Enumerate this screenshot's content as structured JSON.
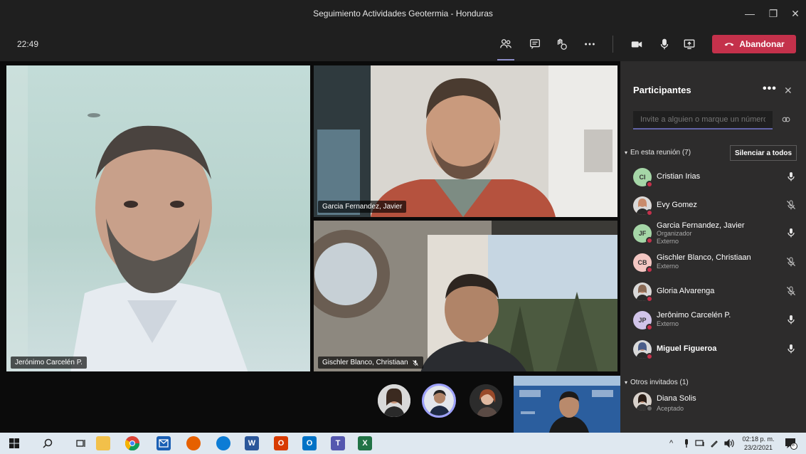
{
  "window": {
    "title": "Seguimiento Actividades Geotermia - Honduras",
    "minimize": "—",
    "restore": "❐",
    "close": "✕"
  },
  "toolbar": {
    "clock": "22:49",
    "leave_label": "Abandonar"
  },
  "tiles": [
    {
      "name": "Jerónimo Carcelén P.",
      "muted": false
    },
    {
      "name": "Garcia Fernandez, Javier",
      "muted": false
    },
    {
      "name": "Gischler Blanco, Christiaan",
      "muted": true
    }
  ],
  "panel": {
    "title": "Participantes",
    "more": "•••",
    "close": "✕",
    "invite_placeholder": "Invite a alguien o marque un número",
    "in_meeting_label": "En esta reunión (7)",
    "mute_all_label": "Silenciar a todos",
    "participants": [
      {
        "initials": "CI",
        "name": "Cristian Irias",
        "role": "",
        "external": "",
        "mic": "on",
        "avatar_color": "#a5d6a7",
        "photo": false,
        "bold": false
      },
      {
        "initials": "",
        "name": "Evy Gomez",
        "role": "",
        "external": "",
        "mic": "off",
        "avatar_color": "#c98b6b",
        "photo": true,
        "bold": false
      },
      {
        "initials": "JF",
        "name": "Garcia Fernandez, Javier",
        "role": "Organizador",
        "external": "Externo",
        "mic": "on",
        "avatar_color": "#a5d6a7",
        "photo": false,
        "bold": false
      },
      {
        "initials": "CB",
        "name": "Gischler Blanco, Christiaan",
        "role": "",
        "external": "Externo",
        "mic": "off",
        "avatar_color": "#f4c7c3",
        "photo": false,
        "bold": false
      },
      {
        "initials": "",
        "name": "Gloria Alvarenga",
        "role": "",
        "external": "",
        "mic": "off",
        "avatar_color": "#8a6a55",
        "photo": true,
        "bold": false
      },
      {
        "initials": "JP",
        "name": "Jerônimo Carcelén P.",
        "role": "",
        "external": "Externo",
        "mic": "on",
        "avatar_color": "#d1c4e9",
        "photo": false,
        "bold": false
      },
      {
        "initials": "",
        "name": "Miguel Figueroa",
        "role": "",
        "external": "",
        "mic": "on",
        "avatar_color": "#4a5d8a",
        "photo": true,
        "bold": true
      }
    ],
    "others_label": "Otros invitados (1)",
    "others": [
      {
        "name": "Diana Solis",
        "status": "Aceptado"
      }
    ]
  },
  "taskbar": {
    "time": "02:18 p. m.",
    "date": "23/2/2021",
    "notifications": "8"
  }
}
